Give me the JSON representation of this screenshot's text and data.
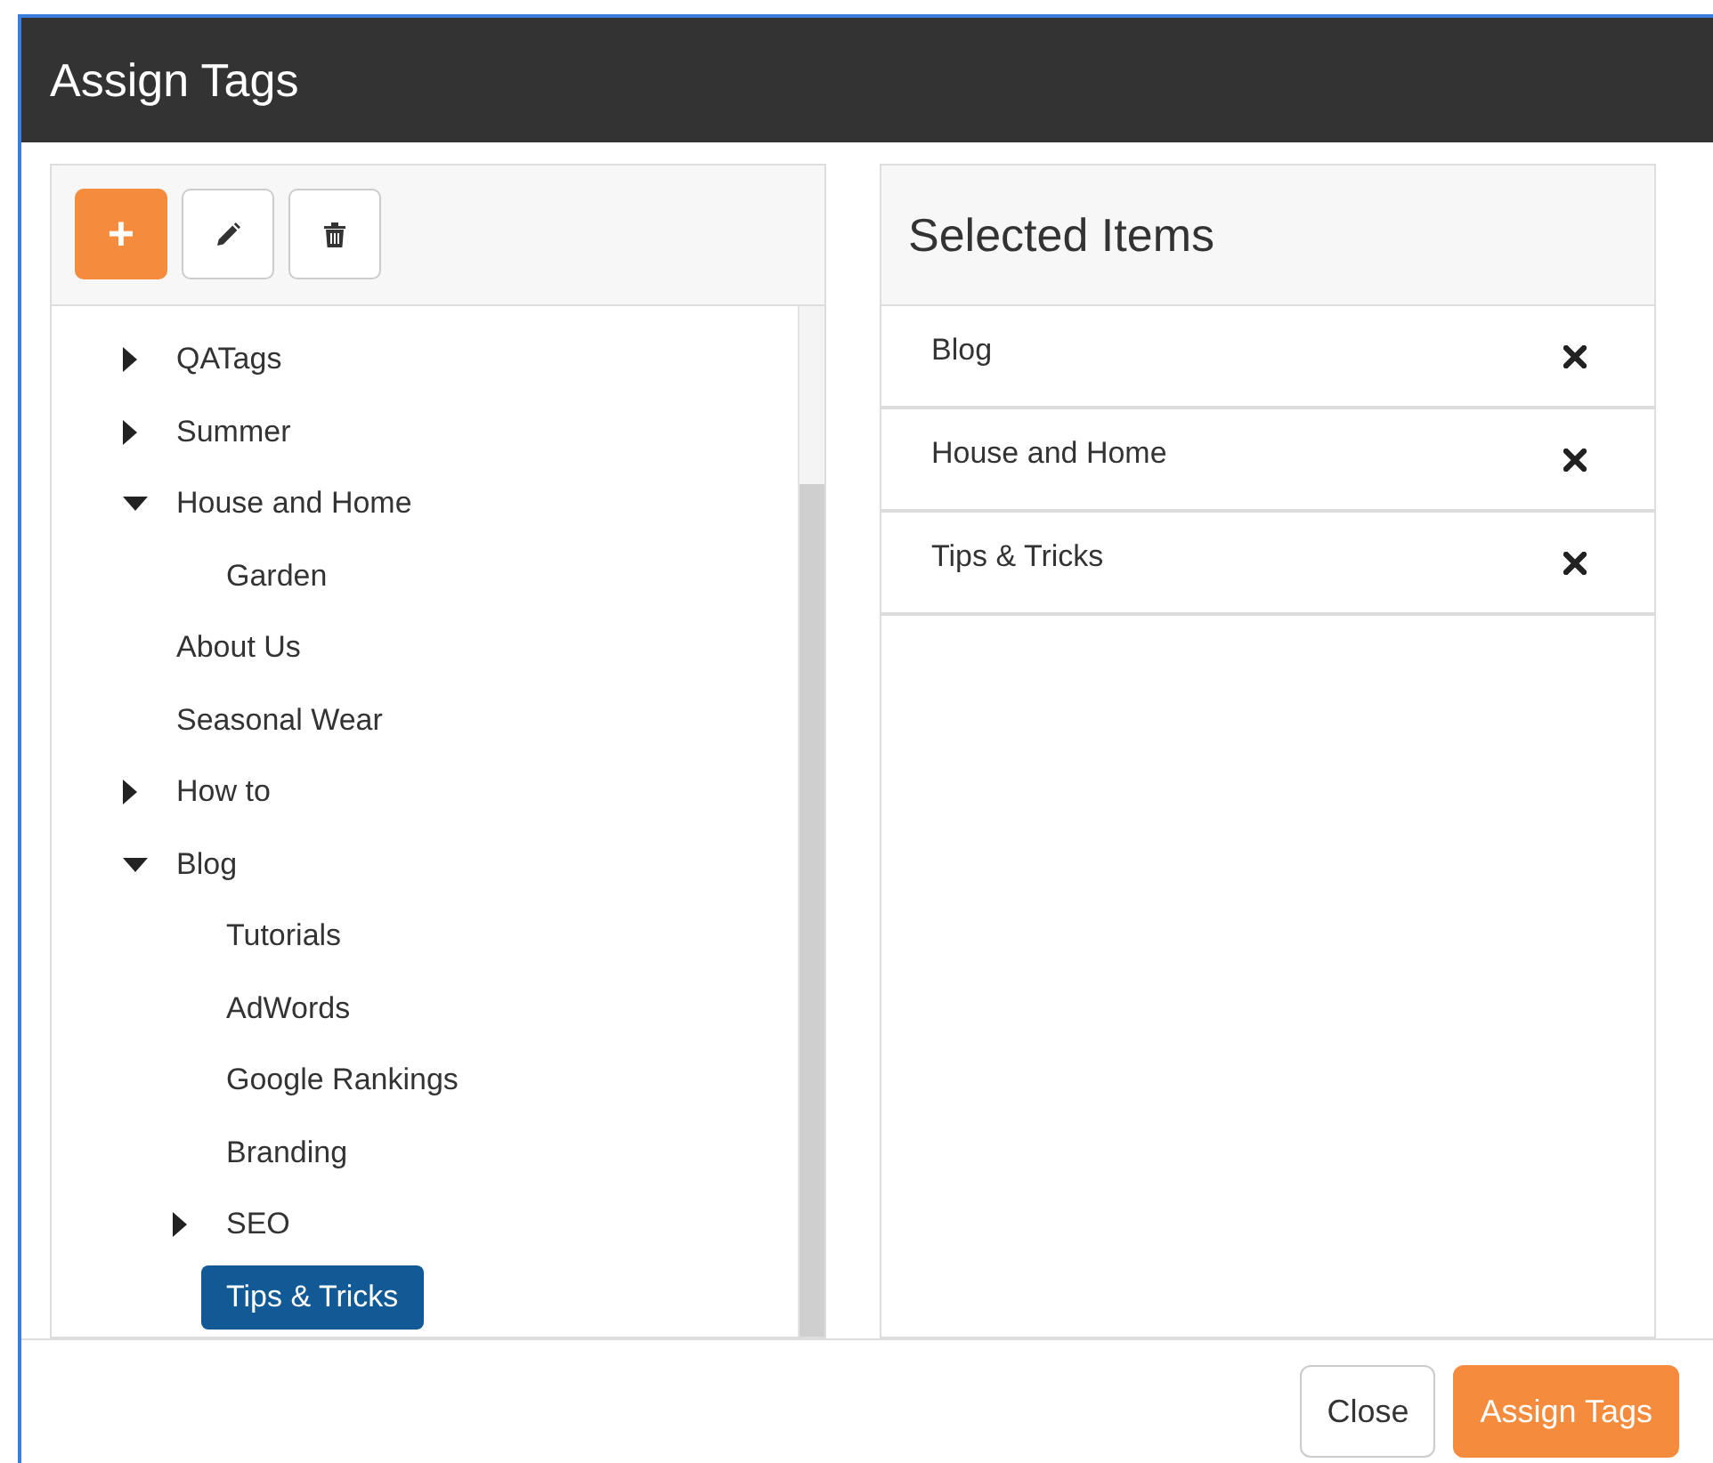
{
  "window": {
    "title": "Assign Tags"
  },
  "toolbar": {
    "buttons": [
      {
        "kind": "add",
        "label": "+"
      },
      {
        "kind": "edit"
      },
      {
        "kind": "delete"
      }
    ]
  },
  "tree": [
    {
      "label": "QATags",
      "expanded": false,
      "selected": false
    },
    {
      "label": "Summer",
      "expanded": false,
      "selected": false
    },
    {
      "label": "House and Home",
      "expanded": true,
      "selected": false,
      "children": [
        {
          "label": "Garden",
          "selected": false
        }
      ]
    },
    {
      "label": "About Us",
      "selected": false
    },
    {
      "label": "Seasonal Wear",
      "selected": false
    },
    {
      "label": "How to",
      "expanded": false,
      "selected": false
    },
    {
      "label": "Blog",
      "expanded": true,
      "selected": false,
      "children": [
        {
          "label": "Tutorials",
          "selected": false
        },
        {
          "label": "AdWords",
          "selected": false
        },
        {
          "label": "Google Rankings",
          "selected": false
        },
        {
          "label": "Branding",
          "selected": false
        },
        {
          "label": "SEO",
          "expanded": false,
          "selected": false
        },
        {
          "label": "Tips & Tricks",
          "selected": true
        }
      ]
    }
  ],
  "selected_panel": {
    "title": "Selected Items",
    "items": [
      "Blog",
      "House and Home",
      "Tips & Tricks"
    ]
  },
  "footer": {
    "buttons": [
      {
        "label": "Close",
        "kind": "default"
      },
      {
        "label": "Assign Tags",
        "kind": "primary"
      }
    ]
  }
}
